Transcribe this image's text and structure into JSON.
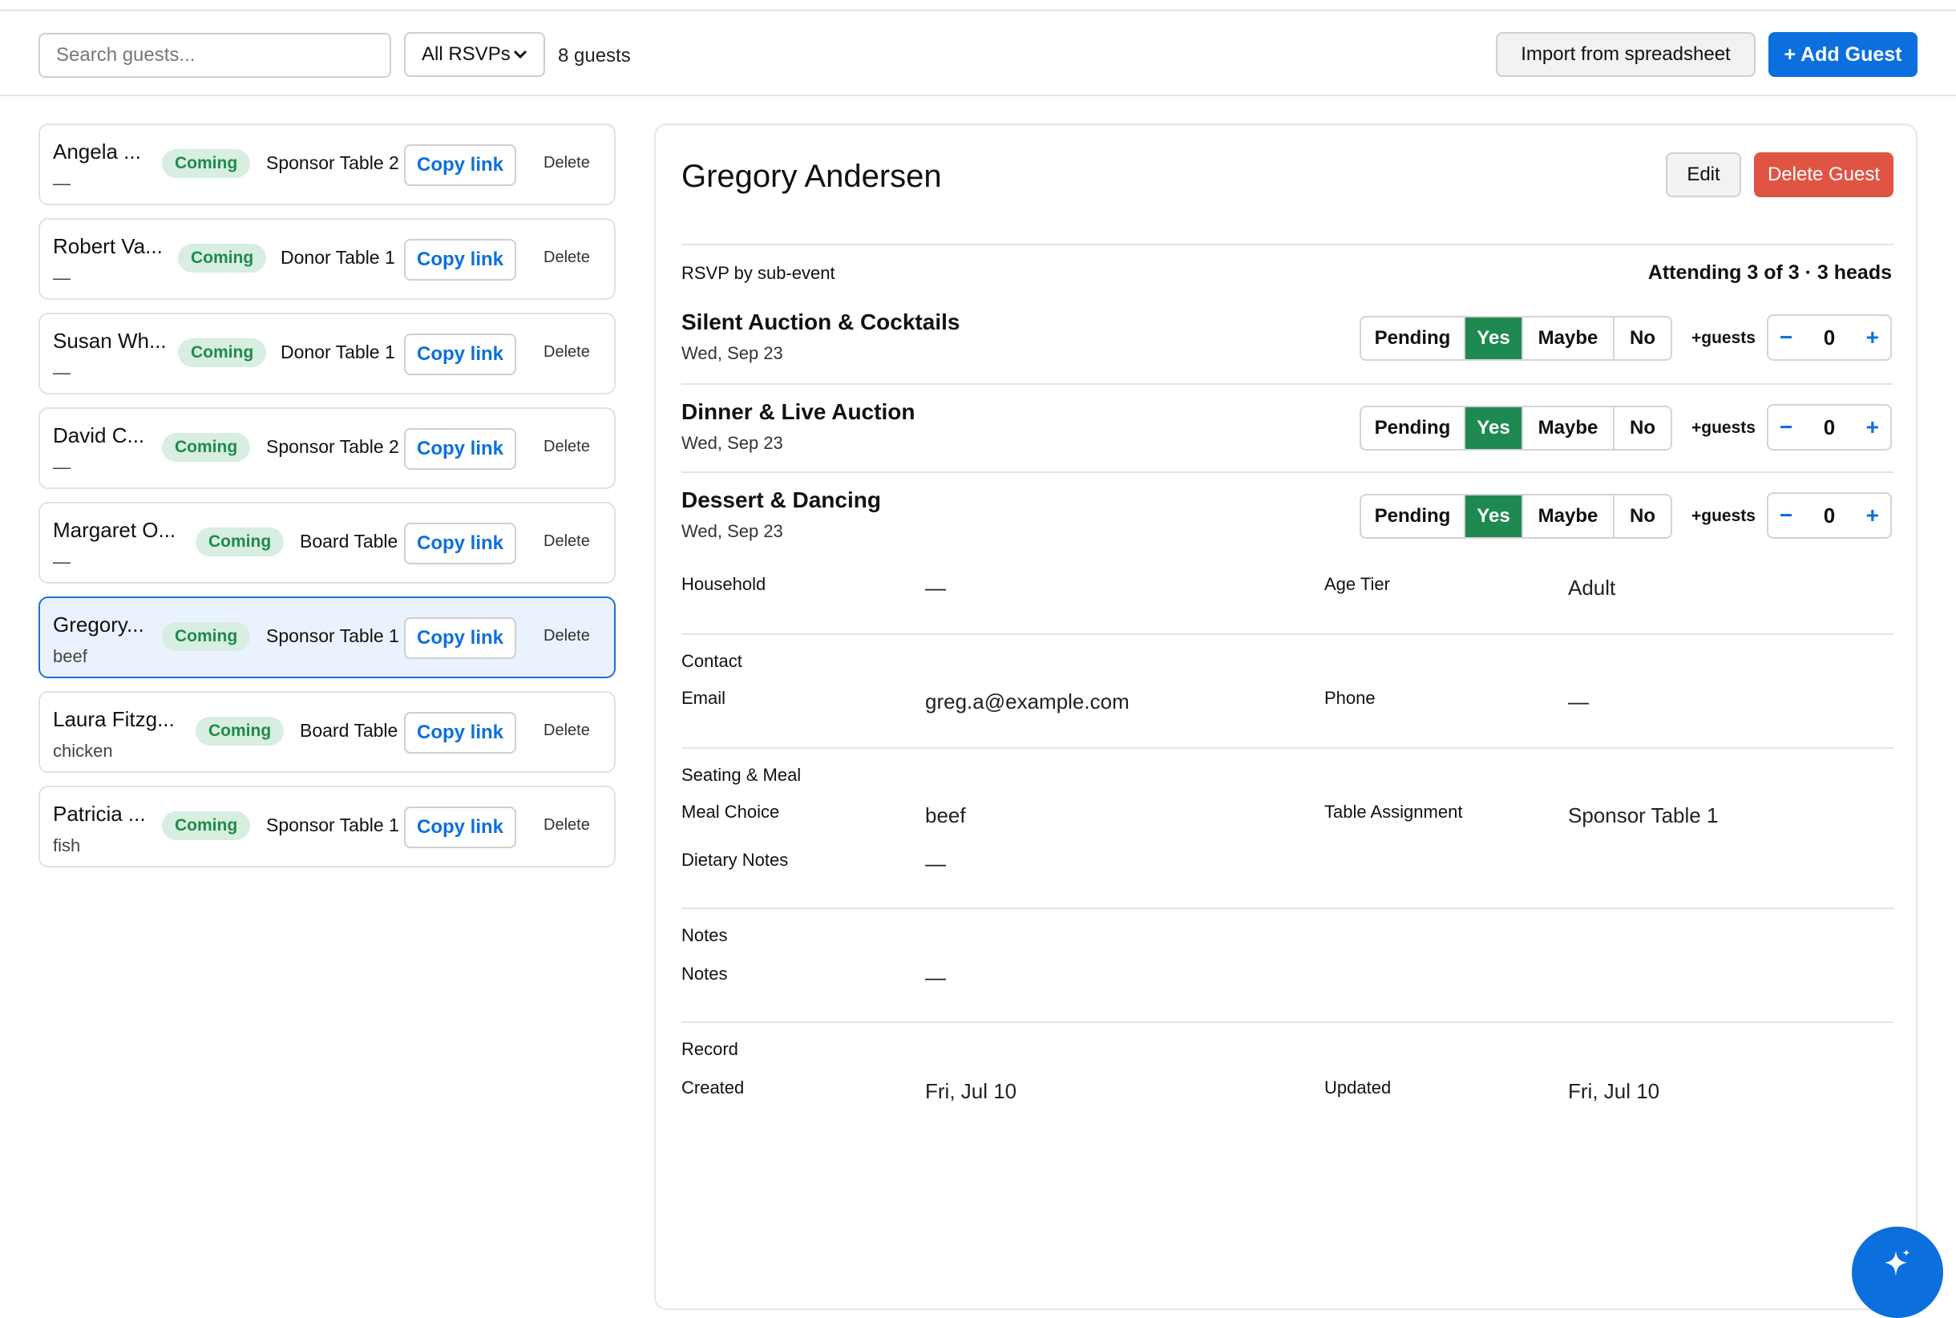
{
  "toolbar": {
    "search_placeholder": "Search guests...",
    "rsvp_filter": "All RSVPs",
    "guest_count": "8 guests",
    "import_label": "Import from spreadsheet",
    "add_label": "+ Add Guest"
  },
  "guests": [
    {
      "name": "Angela ...",
      "meal": "—",
      "status": "Coming",
      "table": "Sponsor Table 2",
      "copy": "Copy link",
      "delete": "Delete"
    },
    {
      "name": "Robert Va...",
      "meal": "—",
      "status": "Coming",
      "table": "Donor Table 1",
      "copy": "Copy link",
      "delete": "Delete"
    },
    {
      "name": "Susan Wh...",
      "meal": "—",
      "status": "Coming",
      "table": "Donor Table 1",
      "copy": "Copy link",
      "delete": "Delete"
    },
    {
      "name": "David C...",
      "meal": "—",
      "status": "Coming",
      "table": "Sponsor Table 2",
      "copy": "Copy link",
      "delete": "Delete"
    },
    {
      "name": "Margaret O...",
      "meal": "—",
      "status": "Coming",
      "table": "Board Table",
      "copy": "Copy link",
      "delete": "Delete"
    },
    {
      "name": "Gregory...",
      "meal": "beef",
      "status": "Coming",
      "table": "Sponsor Table 1",
      "copy": "Copy link",
      "delete": "Delete"
    },
    {
      "name": "Laura Fitzg...",
      "meal": "chicken",
      "status": "Coming",
      "table": "Board Table",
      "copy": "Copy link",
      "delete": "Delete"
    },
    {
      "name": "Patricia ...",
      "meal": "fish",
      "status": "Coming",
      "table": "Sponsor Table 1",
      "copy": "Copy link",
      "delete": "Delete"
    }
  ],
  "detail": {
    "name": "Gregory Andersen",
    "edit_label": "Edit",
    "delete_label": "Delete Guest",
    "rsvp_section": "RSVP by sub-event",
    "attending": "Attending 3 of 3 · 3 heads",
    "events": [
      {
        "name": "Silent Auction & Cocktails",
        "date": "Wed, Sep 23",
        "extra": "0"
      },
      {
        "name": "Dinner & Live Auction",
        "date": "Wed, Sep 23",
        "extra": "0"
      },
      {
        "name": "Dessert & Dancing",
        "date": "Wed, Sep 23",
        "extra": "0"
      }
    ],
    "rsvp_options": {
      "pending": "Pending",
      "yes": "Yes",
      "maybe": "Maybe",
      "no": "No",
      "plus_guests": "+guests",
      "minus": "−",
      "plus": "+"
    },
    "household_label": "Household",
    "household_value": "—",
    "age_tier_label": "Age Tier",
    "age_tier_value": "Adult",
    "contact_section": "Contact",
    "email_label": "Email",
    "email_value": "greg.a@example.com",
    "phone_label": "Phone",
    "phone_value": "—",
    "seating_section": "Seating & Meal",
    "meal_label": "Meal Choice",
    "meal_value": "beef",
    "table_label": "Table Assignment",
    "table_value": "Sponsor Table 1",
    "dietary_label": "Dietary Notes",
    "dietary_value": "—",
    "notes_section": "Notes",
    "notes_label": "Notes",
    "notes_value": "—",
    "record_section": "Record",
    "created_label": "Created",
    "created_value": "Fri, Jul 10",
    "updated_label": "Updated",
    "updated_value": "Fri, Jul 10"
  },
  "icons": {
    "filter_chevron": "chevron-down-icon",
    "fab": "sparkle-icon"
  }
}
